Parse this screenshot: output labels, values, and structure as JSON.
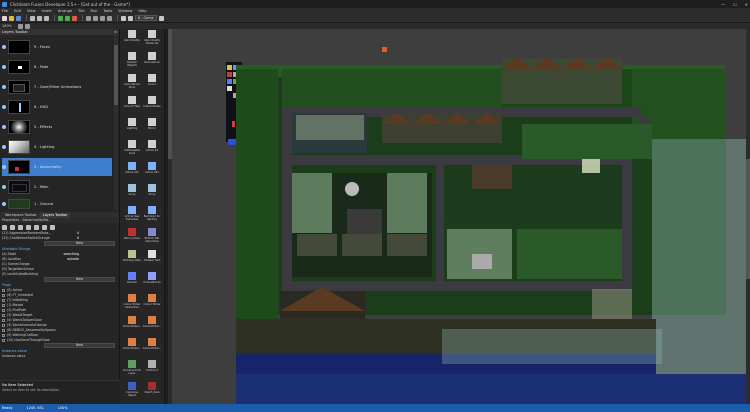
{
  "window": {
    "title": "Clickteam Fusion Developer 2.5+ - [Get out of the - Game*]",
    "minimize": "—",
    "maximize": "☐",
    "close": "✕"
  },
  "menu": [
    "File",
    "Edit",
    "View",
    "Insert",
    "Arrange",
    "Tile",
    "Run",
    "Tools",
    "Window",
    "Help"
  ],
  "toolbar": {
    "frame_select": "8 - Game",
    "zoom": "100%"
  },
  "layers_panel": {
    "title": "Layers Toolbar",
    "layers": [
      {
        "label": "9 - Faces"
      },
      {
        "label": "8 - Fade"
      },
      {
        "label": "7 - Gore/Other Animations"
      },
      {
        "label": "6 - HUD"
      },
      {
        "label": "5 - Effects"
      },
      {
        "label": "4 - Lighting"
      },
      {
        "label": "3 - Abnormality"
      },
      {
        "label": "2 - Main"
      },
      {
        "label": "1 - Ground"
      }
    ]
  },
  "props_panel": {
    "tabs": [
      "Workspace Toolbar",
      "Layers Toolbar"
    ],
    "title": "Properties - AbnormalityMo...",
    "lines_top": [
      {
        "label": "(21) AggressionRandomMuta...",
        "value": "4"
      },
      {
        "label": "(22) CharBeforeSwitchScenge",
        "value": "0"
      }
    ],
    "new_button": "New",
    "alterable_strings_title": "Alterable Strings",
    "strings": [
      {
        "label": "(A) State",
        "value": "searching"
      },
      {
        "label": "(B) Location",
        "value": "outside"
      },
      {
        "label": "(C) SceneChange",
        "value": ""
      },
      {
        "label": "(D) TargetIsInSchool",
        "value": ""
      },
      {
        "label": "(E) LastVisitedBuilding",
        "value": ""
      }
    ],
    "flags_title": "Flags",
    "flags": [
      "(0) Active",
      "(6) FT_Inhabited",
      "(7) isWalking",
      "(1) Moved",
      "(2) FindPath",
      "(3) WasAtTarget",
      "(4) WantsToOpenDoor",
      "(5) SameSceneAsGeorge",
      "(8) DEBUG_AbnormalitySpawn",
      "(9) WalkingOutDoor",
      "(10) HasGoneThroughDoor"
    ],
    "instance_value_title": "Instance value",
    "instance_value_label": "Instance value",
    "desc_title": "No Item Selected",
    "desc_text": "Select an item to see its description"
  },
  "library": {
    "items": [
      {
        "label": "Abnormality",
        "icon": "cube-icon"
      },
      {
        "label": "Abnormality Obstacles",
        "icon": "cube-icon"
      },
      {
        "label": "Outdoor Objects",
        "icon": "cube-icon"
      },
      {
        "label": "Decorations",
        "icon": "cube-icon"
      },
      {
        "label": "Decorations Shop",
        "icon": "cube-icon"
      },
      {
        "label": "Doors",
        "icon": "cube-icon"
      },
      {
        "label": "Ground Tiles",
        "icon": "cube-icon"
      },
      {
        "label": "Interactables",
        "icon": "cube-icon"
      },
      {
        "label": "Lighting",
        "icon": "cube-icon"
      },
      {
        "label": "Mirror",
        "icon": "cube-icon"
      },
      {
        "label": "UnMoveable tools",
        "icon": "cube-icon"
      },
      {
        "label": "Active 16",
        "icon": "cube-icon"
      },
      {
        "label": "Active 247",
        "icon": "active-icon"
      },
      {
        "label": "Active 281",
        "icon": "active-icon"
      },
      {
        "label": "Array",
        "icon": "array-icon"
      },
      {
        "label": "Array",
        "icon": "array-icon"
      },
      {
        "label": "Article_Sea Darkness",
        "icon": "active-icon"
      },
      {
        "label": "Backdrop for lighting",
        "icon": "active-icon"
      },
      {
        "label": "Blood_Close",
        "icon": "blood-icon"
      },
      {
        "label": "Bottom Bar Interactive",
        "icon": "bar-icon"
      },
      {
        "label": "Building Data",
        "icon": "data-icon"
      },
      {
        "label": "Chapter Text",
        "icon": "text-icon"
      },
      {
        "label": "Checker",
        "icon": "checker-icon"
      },
      {
        "label": "ChoiceBlocks",
        "icon": "choice-icon"
      },
      {
        "label": "Colour Picker Interaction",
        "icon": "colour-icon"
      },
      {
        "label": "Colour Picker",
        "icon": "colour-icon"
      },
      {
        "label": "ColourPicker...",
        "icon": "colour-icon"
      },
      {
        "label": "ColourPicker...",
        "icon": "colour-icon"
      },
      {
        "label": "ColourPicker...",
        "icon": "colour-icon"
      },
      {
        "label": "ColourPicker...",
        "icon": "colour-icon"
      },
      {
        "label": "Combine from Layer",
        "icon": "combine-icon"
      },
      {
        "label": "Control X",
        "icon": "control-icon"
      },
      {
        "label": "Cutscene Object",
        "icon": "cutscene-icon"
      },
      {
        "label": "Death_Sale",
        "icon": "death-icon"
      }
    ]
  },
  "status": {
    "left": "Ready",
    "coords": "1245, 631",
    "zoom": "100%"
  },
  "colors": {
    "accent": "#3d7ecf",
    "statusbar": "#1b5cab",
    "grass": "#2f6b2a",
    "road": "#3f3f44",
    "water": "#1a2a6a"
  }
}
